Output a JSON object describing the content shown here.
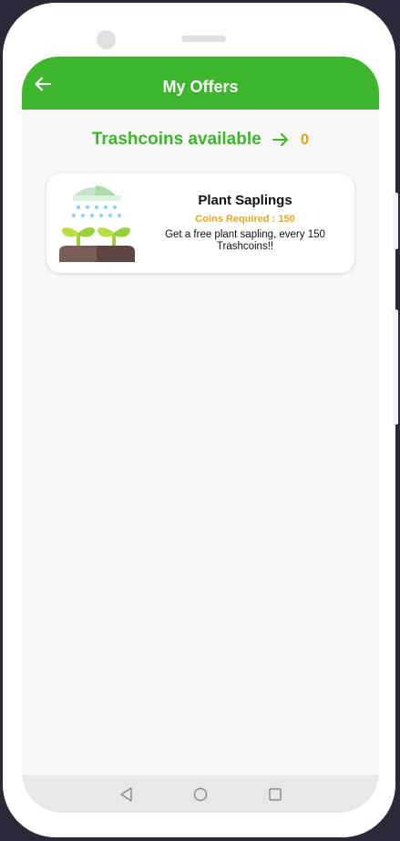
{
  "header": {
    "title": "My Offers"
  },
  "coins": {
    "label": "Trashcoins available",
    "value": "0"
  },
  "offers": [
    {
      "title": "Plant Saplings",
      "coins_required": "Coins Required : 150",
      "description": "Get a free plant sapling, every 150 Trashcoins!!",
      "icon": "plant-sapling-icon"
    }
  ],
  "navigation": {
    "buttons": [
      "back-triangle-icon",
      "home-circle-icon",
      "recents-square-icon"
    ]
  },
  "colors": {
    "accent": "#3db52c",
    "coins": "#e0a81b",
    "background": "#f8f8f8"
  }
}
